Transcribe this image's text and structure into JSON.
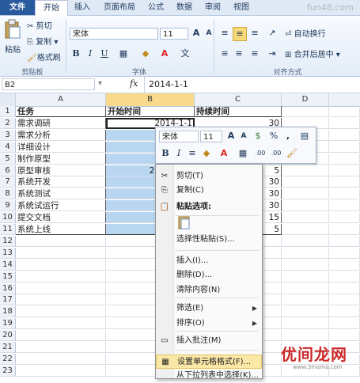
{
  "tabs": [
    "文件",
    "开始",
    "插入",
    "页面布局",
    "公式",
    "数据",
    "审阅",
    "视图"
  ],
  "watermark_top": "fun48.com",
  "ribbon": {
    "paste": "粘贴",
    "cut": "剪切",
    "copy": "复制",
    "format_painter": "格式刷",
    "clipboard_group": "剪贴板",
    "font_name": "宋体",
    "font_size": "11",
    "bold": "B",
    "italic": "I",
    "underline": "U",
    "font_group": "字体",
    "wrap_text": "自动换行",
    "merge_center": "合并后居中",
    "align_group": "对齐方式"
  },
  "formula_bar": {
    "name_box": "B2",
    "fx": "fx",
    "content": "2014-1-1"
  },
  "columns": [
    "A",
    "B",
    "C",
    "D"
  ],
  "rows": [
    {
      "num": "1",
      "a": "任务",
      "b": "开始时间",
      "c": "持续时间"
    },
    {
      "num": "2",
      "a": "需求调研",
      "b": "2014-1-1",
      "c": "30"
    },
    {
      "num": "3",
      "a": "需求分析",
      "b": "2",
      "c": ""
    },
    {
      "num": "4",
      "a": "详细设计",
      "b": "20",
      "c": ""
    },
    {
      "num": "5",
      "a": "制作原型",
      "b": "2",
      "c": ""
    },
    {
      "num": "6",
      "a": "原型审核",
      "b": "2014-3-16",
      "c": "5"
    },
    {
      "num": "7",
      "a": "系统开发",
      "b": "20",
      "c": "30"
    },
    {
      "num": "8",
      "a": "系统测试",
      "b": "20",
      "c": "30"
    },
    {
      "num": "9",
      "a": "系统试运行",
      "b": "20",
      "c": "30"
    },
    {
      "num": "10",
      "a": "提交文档",
      "b": "20",
      "c": "15"
    },
    {
      "num": "11",
      "a": "系统上线",
      "b": "20",
      "c": "5"
    },
    {
      "num": "12",
      "a": "",
      "b": "",
      "c": ""
    },
    {
      "num": "13",
      "a": "",
      "b": "",
      "c": ""
    },
    {
      "num": "14",
      "a": "",
      "b": "",
      "c": ""
    },
    {
      "num": "15",
      "a": "",
      "b": "",
      "c": ""
    },
    {
      "num": "16",
      "a": "",
      "b": "",
      "c": ""
    },
    {
      "num": "17",
      "a": "",
      "b": "",
      "c": ""
    },
    {
      "num": "18",
      "a": "",
      "b": "",
      "c": ""
    },
    {
      "num": "19",
      "a": "",
      "b": "",
      "c": ""
    },
    {
      "num": "20",
      "a": "",
      "b": "",
      "c": ""
    },
    {
      "num": "21",
      "a": "",
      "b": "",
      "c": ""
    },
    {
      "num": "22",
      "a": "",
      "b": "",
      "c": ""
    },
    {
      "num": "23",
      "a": "",
      "b": "",
      "c": ""
    }
  ],
  "mini_toolbar": {
    "font_name": "宋体",
    "font_size": "11",
    "grow": "A",
    "shrink": "A",
    "currency": "$",
    "percent": "%",
    "comma": ",",
    "bold": "B",
    "italic": "I",
    "decimals": ".00"
  },
  "context_menu": [
    {
      "label": "剪切(T)",
      "icon": "scissors-icon",
      "submenu": false
    },
    {
      "label": "复制(C)",
      "icon": "copy-icon",
      "submenu": false
    },
    {
      "label": "粘贴选项:",
      "icon": "paste-icon",
      "submenu": false,
      "bold": true
    },
    {
      "label": "选择性粘贴(S)...",
      "icon": "",
      "submenu": false
    },
    {
      "label": "插入(I)...",
      "icon": "",
      "submenu": false
    },
    {
      "label": "删除(D)...",
      "icon": "",
      "submenu": false
    },
    {
      "label": "清除内容(N)",
      "icon": "",
      "submenu": false
    },
    {
      "label": "筛选(E)",
      "icon": "",
      "submenu": true
    },
    {
      "label": "排序(O)",
      "icon": "",
      "submenu": true
    },
    {
      "label": "插入批注(M)",
      "icon": "comment-icon",
      "submenu": false
    },
    {
      "label": "设置单元格格式(F)...",
      "icon": "format-cells-icon",
      "submenu": false
    },
    {
      "label": "从下拉列表中选择(K)...",
      "icon": "",
      "submenu": false
    }
  ],
  "watermark_bottom": "优间龙网",
  "watermark_small": "www.3mama.com"
}
